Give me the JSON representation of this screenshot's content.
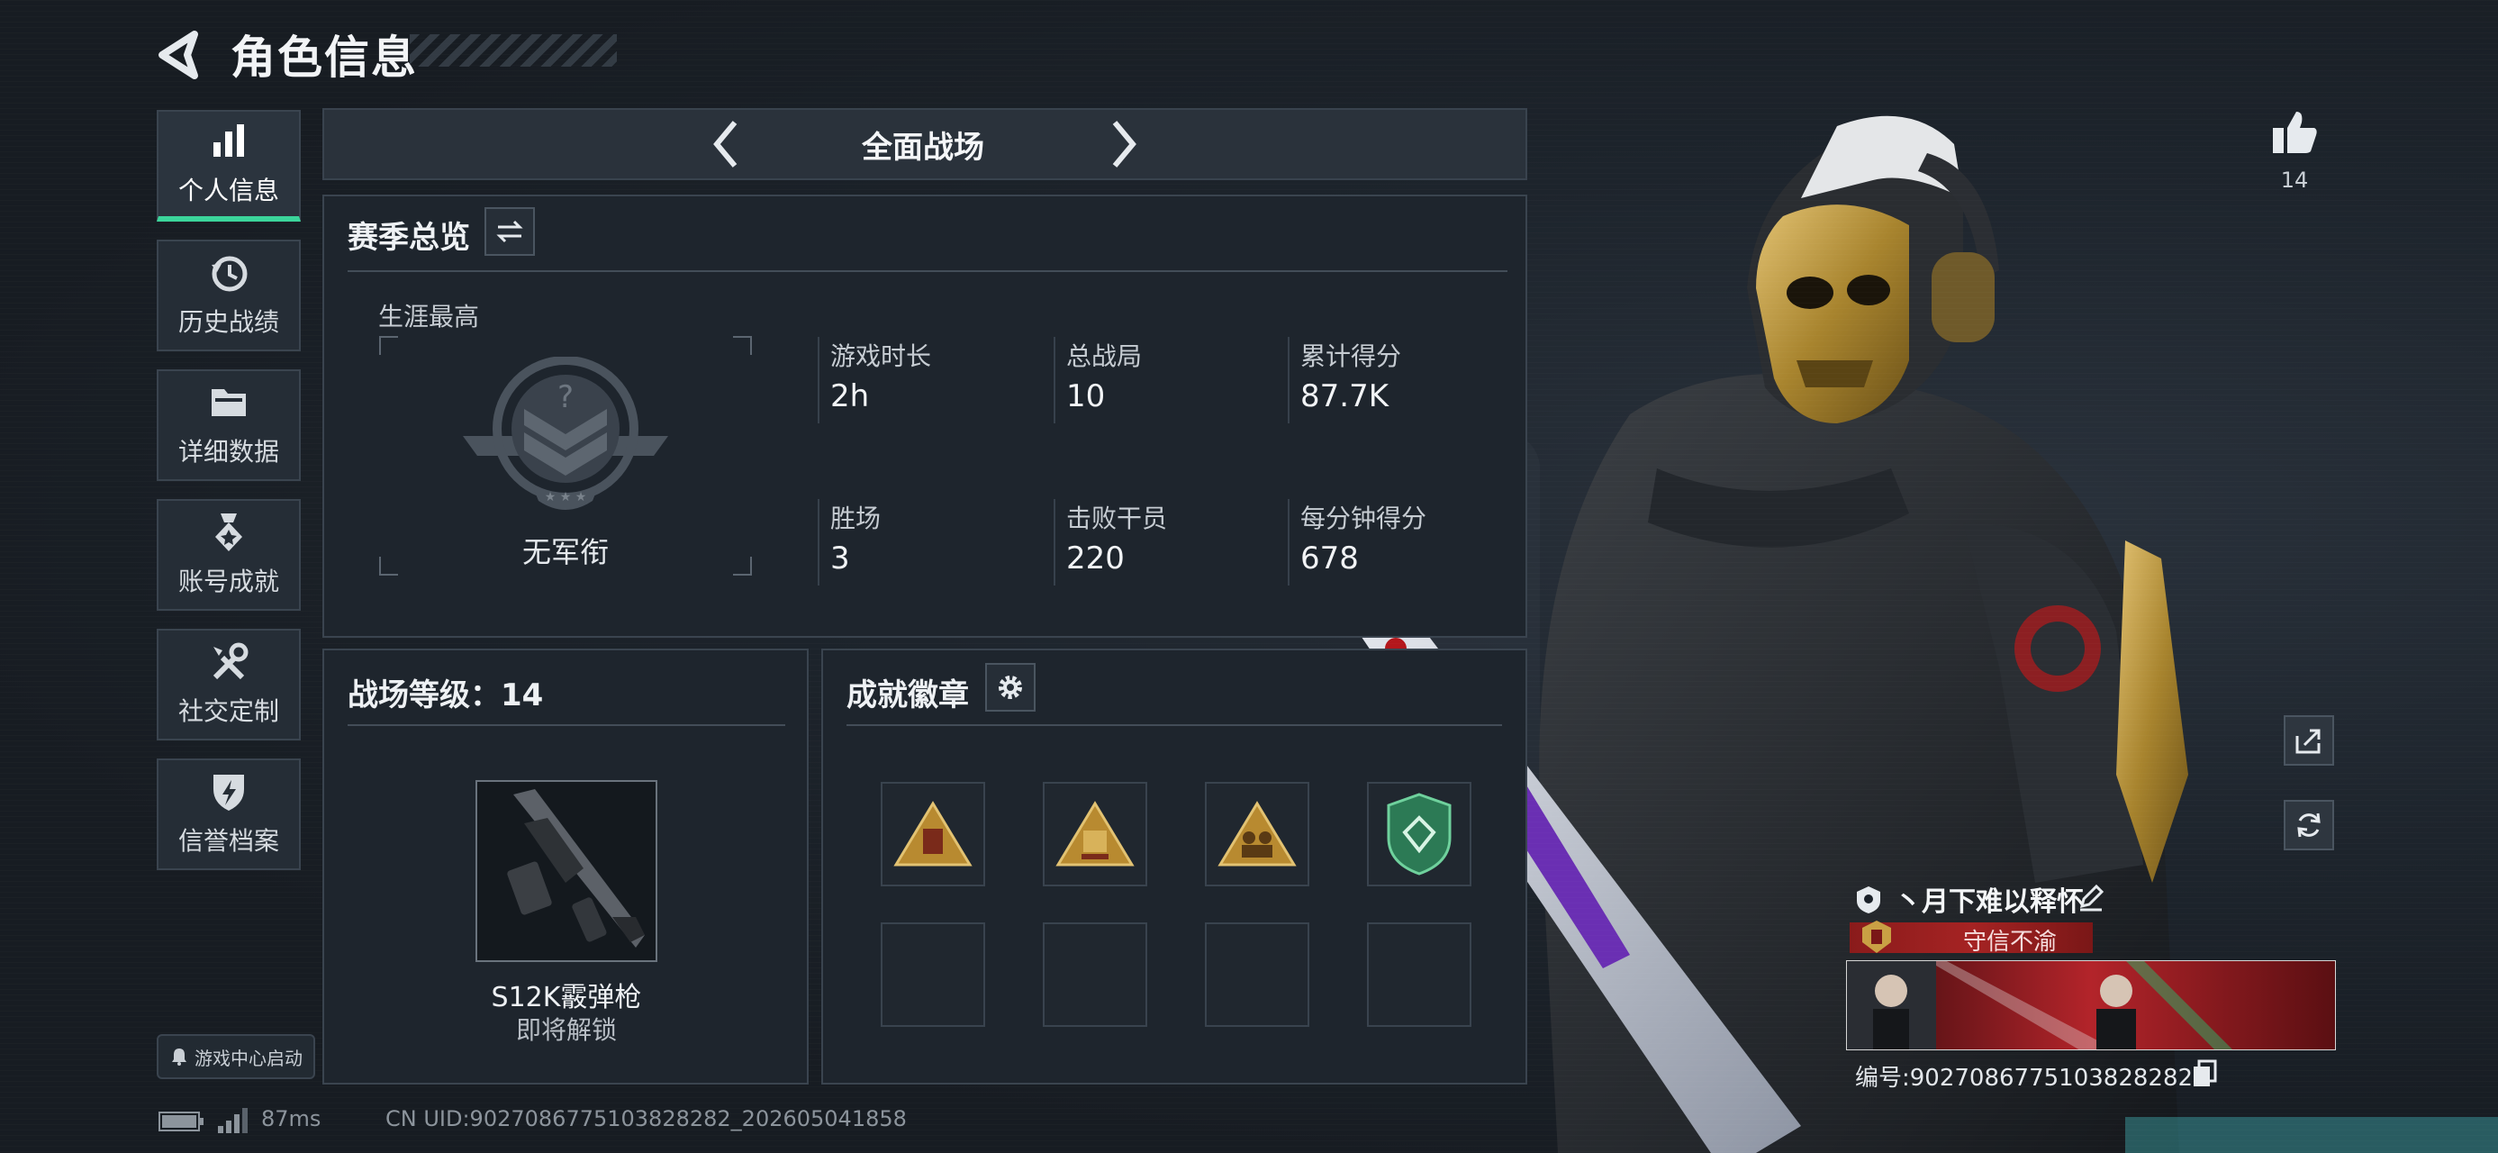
{
  "header": {
    "title": "角色信息"
  },
  "sidebar": {
    "items": [
      {
        "label": "个人信息",
        "icon": "bar-chart-icon",
        "active": true
      },
      {
        "label": "历史战绩",
        "icon": "history-clock-icon",
        "active": false
      },
      {
        "label": "详细数据",
        "icon": "folder-icon",
        "active": false
      },
      {
        "label": "账号成就",
        "icon": "achievement-medal-icon",
        "active": false
      },
      {
        "label": "社交定制",
        "icon": "tools-icon",
        "active": false
      },
      {
        "label": "信誉档案",
        "icon": "shield-lightning-icon",
        "active": false
      }
    ],
    "launch_label": "游戏中心启动"
  },
  "mode": {
    "title": "全面战场"
  },
  "season": {
    "title": "赛季总览",
    "career_label": "生涯最高",
    "rank_label": "无军衔",
    "stats": [
      {
        "label": "游戏时长",
        "value": "2h"
      },
      {
        "label": "总战局",
        "value": "10"
      },
      {
        "label": "累计得分",
        "value": "87.7K"
      },
      {
        "label": "胜场",
        "value": "3"
      },
      {
        "label": "击败干员",
        "value": "220"
      },
      {
        "label": "每分钟得分",
        "value": "678"
      }
    ]
  },
  "level": {
    "title": "战场等级：14",
    "weapon_name": "S12K霰弹枪",
    "weapon_status": "即将解锁"
  },
  "achievements": {
    "title": "成就徽章"
  },
  "player": {
    "likes": "14",
    "name": "丶月下难以释怀",
    "honor": "守信不渝",
    "id": "编号:9027086775103828282"
  },
  "footer": {
    "ping": "87ms",
    "uid": "CN UID:9027086775103828282_202605041858"
  },
  "colors": {
    "accent": "#3bd59b",
    "honor": "#a52323",
    "gold": "#c9a044"
  }
}
